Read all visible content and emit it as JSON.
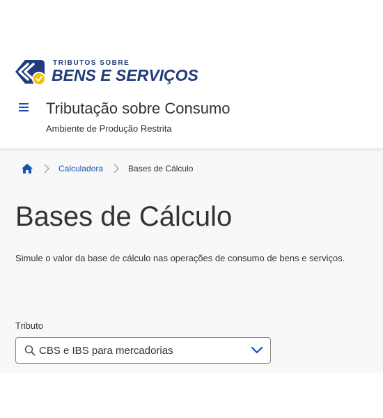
{
  "header": {
    "logo": {
      "line1": "TRIBUTOS SOBRE",
      "line2": "BENS E SERVIÇOS"
    },
    "app_title": "Tributação sobre Consumo",
    "app_subtitle": "Ambiente de Produção Restrita",
    "menu_icon": "hamburger-menu-icon"
  },
  "breadcrumb": {
    "home_icon": "home-icon",
    "items": [
      {
        "label": "Calculadora"
      },
      {
        "label": "Bases de Cálculo"
      }
    ]
  },
  "page": {
    "title": "Bases de Cálculo",
    "description": "Simule o valor da base de cálculo nas operações de consumo de bens e serviços."
  },
  "form": {
    "tributo": {
      "label": "Tributo",
      "value": "CBS e IBS para mercadorias",
      "search_icon": "search-icon",
      "chevron_icon": "chevron-down-icon"
    }
  },
  "colors": {
    "primary": "#1351b4",
    "logo_blue": "#1f3b7a",
    "logo_yellow": "#f5c000",
    "text": "#333333",
    "background": "#f8f8f8"
  }
}
